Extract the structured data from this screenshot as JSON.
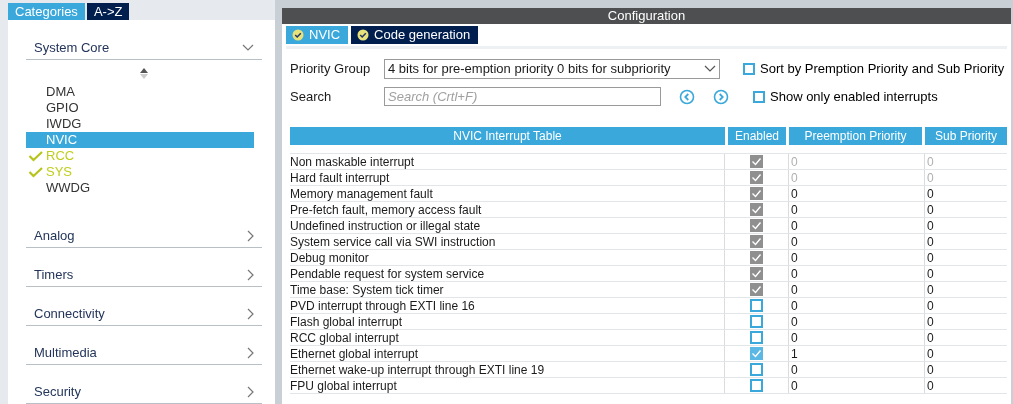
{
  "left_tabs": [
    {
      "label": "Categories",
      "selected": true
    },
    {
      "label": "A->Z",
      "selected": false
    }
  ],
  "categories": [
    {
      "label": "System Core",
      "expanded": true,
      "items": [
        {
          "label": "DMA",
          "checked": false,
          "selected": false
        },
        {
          "label": "GPIO",
          "checked": false,
          "selected": false
        },
        {
          "label": "IWDG",
          "checked": false,
          "selected": false
        },
        {
          "label": "NVIC",
          "checked": false,
          "selected": true
        },
        {
          "label": "RCC",
          "checked": true,
          "selected": false
        },
        {
          "label": "SYS",
          "checked": true,
          "selected": false
        },
        {
          "label": "WWDG",
          "checked": false,
          "selected": false
        }
      ]
    },
    {
      "label": "Analog",
      "expanded": false
    },
    {
      "label": "Timers",
      "expanded": false
    },
    {
      "label": "Connectivity",
      "expanded": false
    },
    {
      "label": "Multimedia",
      "expanded": false
    },
    {
      "label": "Security",
      "expanded": false
    }
  ],
  "config": {
    "title": "Configuration",
    "tabs": [
      {
        "label": "NVIC",
        "selected": true
      },
      {
        "label": "Code generation",
        "selected": false
      }
    ],
    "priority_group": {
      "label": "Priority Group",
      "value": "4 bits for pre-emption priority 0 bits for subpriority"
    },
    "search": {
      "label": "Search",
      "placeholder": "Search (Crtl+F)"
    },
    "options": [
      {
        "label": "Sort by Premption Priority and Sub Priority",
        "checked": false
      },
      {
        "label": "Show only enabled interrupts",
        "checked": false
      }
    ],
    "table": {
      "columns": [
        "NVIC Interrupt Table",
        "Enabled",
        "Preemption Priority",
        "Sub Priority"
      ],
      "rows": [
        {
          "name": "Non maskable interrupt",
          "enabled": true,
          "locked": true,
          "preemption": "0",
          "sub": "0",
          "priority_disabled": true
        },
        {
          "name": "Hard fault interrupt",
          "enabled": true,
          "locked": true,
          "preemption": "0",
          "sub": "0",
          "priority_disabled": true
        },
        {
          "name": "Memory management fault",
          "enabled": true,
          "locked": true,
          "preemption": "0",
          "sub": "0",
          "priority_disabled": false
        },
        {
          "name": "Pre-fetch fault, memory access fault",
          "enabled": true,
          "locked": true,
          "preemption": "0",
          "sub": "0",
          "priority_disabled": false
        },
        {
          "name": "Undefined instruction or illegal state",
          "enabled": true,
          "locked": true,
          "preemption": "0",
          "sub": "0",
          "priority_disabled": false
        },
        {
          "name": "System service call via SWI instruction",
          "enabled": true,
          "locked": true,
          "preemption": "0",
          "sub": "0",
          "priority_disabled": false
        },
        {
          "name": "Debug monitor",
          "enabled": true,
          "locked": true,
          "preemption": "0",
          "sub": "0",
          "priority_disabled": false
        },
        {
          "name": "Pendable request for system service",
          "enabled": true,
          "locked": true,
          "preemption": "0",
          "sub": "0",
          "priority_disabled": false
        },
        {
          "name": "Time base: System tick timer",
          "enabled": true,
          "locked": true,
          "preemption": "0",
          "sub": "0",
          "priority_disabled": false
        },
        {
          "name": "PVD interrupt through EXTI line 16",
          "enabled": false,
          "locked": false,
          "preemption": "0",
          "sub": "0",
          "priority_disabled": false
        },
        {
          "name": "Flash global interrupt",
          "enabled": false,
          "locked": false,
          "preemption": "0",
          "sub": "0",
          "priority_disabled": false
        },
        {
          "name": "RCC global interrupt",
          "enabled": false,
          "locked": false,
          "preemption": "0",
          "sub": "0",
          "priority_disabled": false
        },
        {
          "name": "Ethernet global interrupt",
          "enabled": true,
          "locked": false,
          "preemption": "1",
          "sub": "0",
          "priority_disabled": false
        },
        {
          "name": "Ethernet wake-up interrupt through EXTI line 19",
          "enabled": false,
          "locked": false,
          "preemption": "0",
          "sub": "0",
          "priority_disabled": false
        },
        {
          "name": "FPU global interrupt",
          "enabled": false,
          "locked": false,
          "preemption": "0",
          "sub": "0",
          "priority_disabled": false
        }
      ]
    }
  }
}
